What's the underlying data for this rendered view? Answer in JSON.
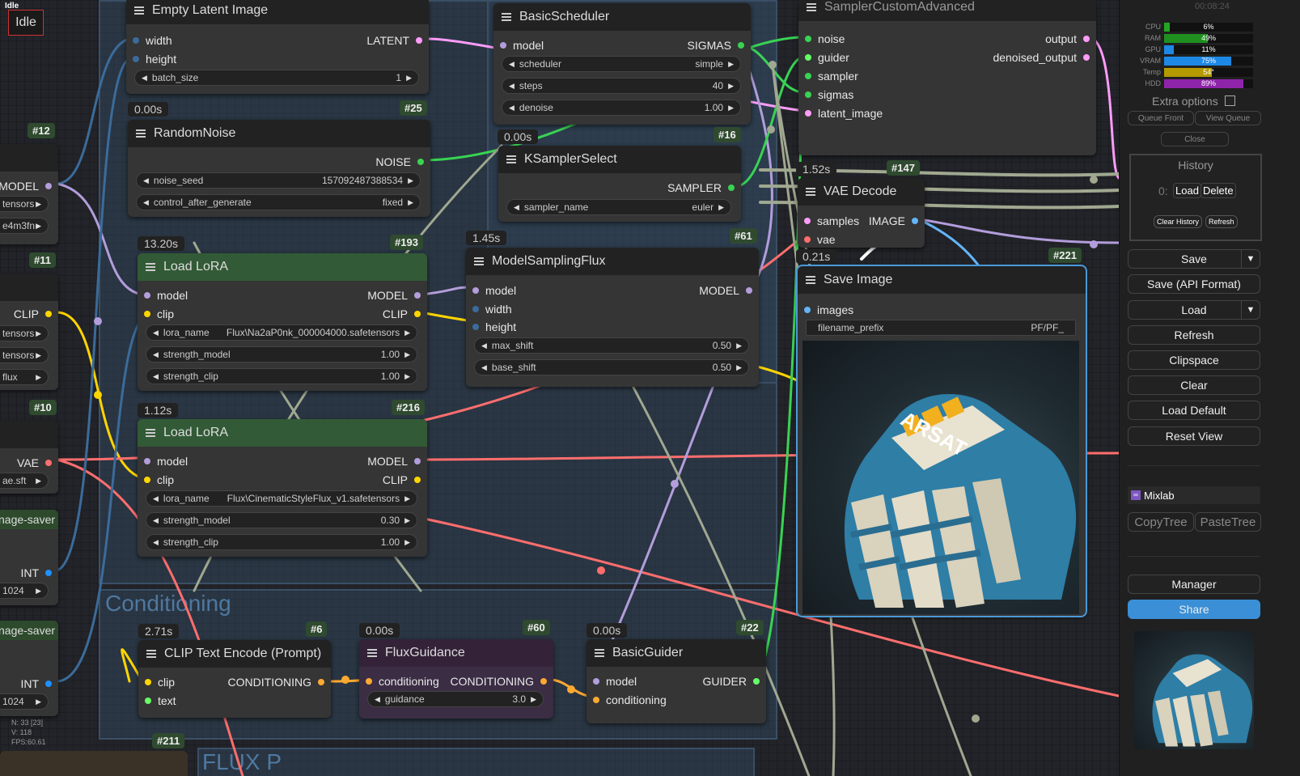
{
  "app": {
    "status_window": "Idle",
    "queue_status": "Idle"
  },
  "colors": {
    "model": "#b39ddb",
    "clip": "#ffd500",
    "vae": "#ff6e6e",
    "latent": "#ff9cf9",
    "image": "#64b5f6",
    "int": "#1e90ff",
    "noise": "#39d353",
    "sigmas": "#39d353",
    "conditioning": "#ffa931",
    "guider": "#66ff66",
    "sampler": "#39d353",
    "accent_share": "#3a8fd6"
  },
  "groups": {
    "conditioning": "Conditioning",
    "flux": "FLUX P"
  },
  "left_nodes": {
    "n12": {
      "badge": "#12",
      "out": "MODEL",
      "w1": "tensors",
      "w2": "e4m3fn"
    },
    "n11": {
      "badge": "#11",
      "out": "CLIP",
      "w1": "tensors",
      "w2": "tensors",
      "w3": "flux"
    },
    "n10": {
      "badge": "#10",
      "out": "VAE",
      "w1": "ae.sft"
    },
    "int1": {
      "title": "nage-saver",
      "out": "INT",
      "w1": "1024"
    },
    "int2": {
      "title": "nage-saver",
      "out": "INT",
      "w1": "1024"
    },
    "stats": {
      "n": "N: 33 [23]",
      "v": "V: 118",
      "fps": "FPS:60.61"
    },
    "n211": {
      "badge": "#211"
    }
  },
  "empty_latent": {
    "title": "Empty Latent Image",
    "in1": "width",
    "in2": "height",
    "out": "LATENT",
    "w_label": "batch_size",
    "w_value": "1"
  },
  "random_noise": {
    "timing": "0.00s",
    "badge": "#25",
    "title": "RandomNoise",
    "out": "NOISE",
    "w1_label": "noise_seed",
    "w1_value": "157092487388534",
    "w2_label": "control_after_generate",
    "w2_value": "fixed"
  },
  "lora1": {
    "timing": "13.20s",
    "badge": "#193",
    "title": "Load LoRA",
    "in1": "model",
    "in2": "clip",
    "out1": "MODEL",
    "out2": "CLIP",
    "w1_label": "lora_name",
    "w1_value": "Flux\\Na2aP0nk_000004000.safetensors",
    "w2_label": "strength_model",
    "w2_value": "1.00",
    "w3_label": "strength_clip",
    "w3_value": "1.00"
  },
  "lora2": {
    "timing": "1.12s",
    "badge": "#216",
    "title": "Load LoRA",
    "in1": "model",
    "in2": "clip",
    "out1": "MODEL",
    "out2": "CLIP",
    "w1_label": "lora_name",
    "w1_value": "Flux\\CinematicStyleFlux_v1.safetensors",
    "w2_label": "strength_model",
    "w2_value": "0.30",
    "w3_label": "strength_clip",
    "w3_value": "1.00"
  },
  "basic_scheduler": {
    "title": "BasicScheduler",
    "in1": "model",
    "out": "SIGMAS",
    "w1_label": "scheduler",
    "w1_value": "simple",
    "w2_label": "steps",
    "w2_value": "40",
    "w3_label": "denoise",
    "w3_value": "1.00"
  },
  "ksampler_select": {
    "timing": "0.00s",
    "badge": "#16",
    "title": "KSamplerSelect",
    "out": "SAMPLER",
    "w_label": "sampler_name",
    "w_value": "euler"
  },
  "model_sampling_flux": {
    "timing": "1.45s",
    "badge": "#61",
    "title": "ModelSamplingFlux",
    "in1": "model",
    "in2": "width",
    "in3": "height",
    "out": "MODEL",
    "w1_label": "max_shift",
    "w1_value": "0.50",
    "w2_label": "base_shift",
    "w2_value": "0.50"
  },
  "sampler_custom": {
    "title": "SamplerCustomAdvanced",
    "in1": "noise",
    "in2": "guider",
    "in3": "sampler",
    "in4": "sigmas",
    "in5": "latent_image",
    "out1": "output",
    "out2": "denoised_output"
  },
  "vae_decode": {
    "timing": "1.52s",
    "badge": "#147",
    "title": "VAE Decode",
    "in1": "samples",
    "in2": "vae",
    "out": "IMAGE"
  },
  "save_image": {
    "timing": "0.21s",
    "badge": "#221",
    "title": "Save Image",
    "in1": "images",
    "w_label": "filename_prefix",
    "w_value": "PF/PF_"
  },
  "clip_text": {
    "timing": "2.71s",
    "badge": "#6",
    "title": "CLIP Text Encode (Prompt)",
    "in1": "clip",
    "in2": "text",
    "out": "CONDITIONING"
  },
  "flux_guidance": {
    "timing": "0.00s",
    "badge": "#60",
    "title": "FluxGuidance",
    "in1": "conditioning",
    "out": "CONDITIONING",
    "w_label": "guidance",
    "w_value": "3.0"
  },
  "basic_guider": {
    "timing": "0.00s",
    "badge": "#22",
    "title": "BasicGuider",
    "in1": "model",
    "in2": "conditioning",
    "out": "GUIDER"
  },
  "image_text": {
    "brand": "ARSAT"
  },
  "panel": {
    "timer": "00:08:24",
    "stats": [
      {
        "label": "CPU",
        "value": "6%",
        "pct": 6,
        "color": "#22a622"
      },
      {
        "label": "RAM",
        "value": "49%",
        "pct": 49,
        "color": "#1f8f1f"
      },
      {
        "label": "GPU",
        "value": "11%",
        "pct": 11,
        "color": "#1e88e5"
      },
      {
        "label": "VRAM",
        "value": "75%",
        "pct": 75,
        "color": "#1e88e5"
      },
      {
        "label": "Temp",
        "value": "54°",
        "pct": 54,
        "color": "#b59a00"
      },
      {
        "label": "HDD",
        "value": "89%",
        "pct": 89,
        "color": "#8e24aa"
      }
    ],
    "extra_options": "Extra options",
    "queue_front": "Queue Front",
    "view_queue": "View Queue",
    "close": "Close",
    "history_title": "History",
    "history_index": "0:",
    "history_load": "Load",
    "history_delete": "Delete",
    "clear_history": "Clear History",
    "refresh_small": "Refresh",
    "buttons": {
      "save": "Save",
      "save_api": "Save (API Format)",
      "load": "Load",
      "refresh": "Refresh",
      "clipspace": "Clipspace",
      "clear": "Clear",
      "load_default": "Load Default",
      "reset_view": "Reset View"
    },
    "mixlab": "Mixlab",
    "copy_tree": "CopyTree",
    "paste_tree": "PasteTree",
    "manager": "Manager",
    "share": "Share"
  }
}
